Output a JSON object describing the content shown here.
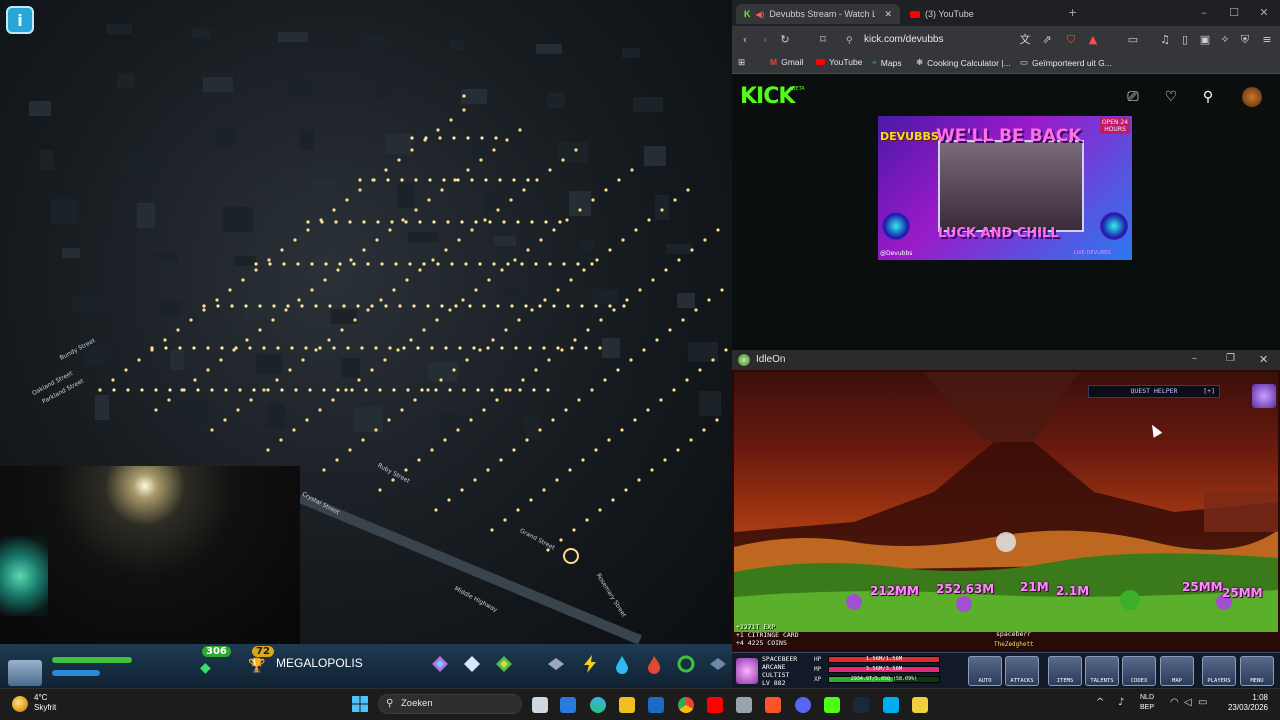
{
  "browser": {
    "tabs": [
      {
        "label": "Devubbs Stream - Watch Live",
        "active": true
      },
      {
        "label": "(3) YouTube",
        "active": false
      }
    ],
    "url": "kick.com/devubbs",
    "bookmarks": [
      "Gmail",
      "YouTube",
      "Maps",
      "Cooking Calculator |...",
      "Geïmporteerd uit G..."
    ]
  },
  "kick": {
    "logo": "KICK",
    "beta": "BETA",
    "thumbnail": {
      "channel": "DEVUBBS",
      "headline": "WE'LL BE BACK",
      "tagline": "LUCK AND CHILL",
      "badge": "OPEN 24 HOURS",
      "footer_left": "@Devubbs",
      "footer_right": "LIVE-DEVUBBS"
    }
  },
  "city": {
    "streets": [
      "Parkland Street",
      "Oakland Street",
      "Bundy Street",
      "Ruby Street",
      "Grand Street",
      "Middle Highway",
      "Crystal Street",
      "Rosemary Street"
    ],
    "hud": {
      "population_badge": "306",
      "level_badge": "72",
      "milestone": "MEGALOPOLIS"
    }
  },
  "idleon": {
    "window_title": "IdleOn",
    "quest_helper": "QUEST HELPER",
    "quest_helper_toggle": "[+]",
    "damage_numbers": [
      "212MM",
      "252.63M",
      "21M",
      "2.1M",
      "25MM",
      "25MM"
    ],
    "log": [
      "+2271T EXP",
      "+1 CITRINGE CARD",
      "+4 4225 COINS"
    ],
    "player_tag": "spaceberr",
    "player_sub": "TheZedghett",
    "char": {
      "name": "SPACEBEER",
      "class": "ARCANE",
      "class2": "CULTIST",
      "level": "LV 882"
    },
    "stats": {
      "hp_label": "HP",
      "mp_label": "MP",
      "xp_label": "XP",
      "hp_text": "1.56M/1.56M",
      "mp_text": "3.56M/3.56M",
      "xp_text": "2934.9T/5.05Q (58.09%)",
      "hp_fill": 1.0,
      "mp_fill": 1.0,
      "xp_fill": 0.58
    },
    "buttons": [
      "AUTO",
      "ATTACKS",
      "ITEMS",
      "TALENTS",
      "CODEX",
      "MAP",
      "PLAYERS",
      "MENU"
    ]
  },
  "taskbar": {
    "temperature": "4°C",
    "condition": "Skyfrit",
    "search_placeholder": "Zoeken",
    "language": "NLD",
    "layout": "BEP",
    "time": "1:08",
    "date": "23/03/2026"
  },
  "colors": {
    "kick_green": "#53fc18",
    "kick_bg": "#0b0e0f",
    "lava": "#e0742a"
  }
}
